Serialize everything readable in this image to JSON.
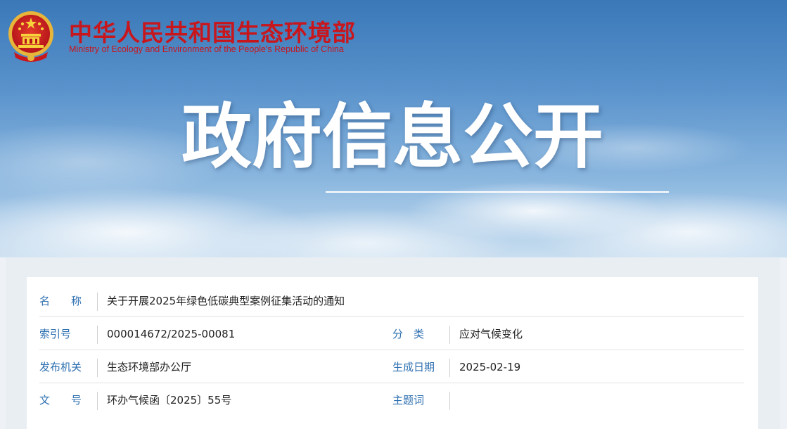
{
  "header": {
    "ministry_cn": "中华人民共和国生态环境部",
    "ministry_en": "Ministry of Ecology and Environment of the People's Republic of China",
    "emblem_icon": "national-emblem-icon"
  },
  "banner": {
    "title": "政府信息公开"
  },
  "info": {
    "name_label": "名　　称",
    "name_value": "关于开展2025年绿色低碳典型案例征集活动的通知",
    "index_label": "索引号",
    "index_value": "000014672/2025-00081",
    "category_label": "分　类",
    "category_value": "应对气候变化",
    "publisher_label": "发布机关",
    "publisher_value": "生态环境部办公厅",
    "date_label": "生成日期",
    "date_value": "2025-02-19",
    "docno_label": "文　　号",
    "docno_value": "环办气候函〔2025〕55号",
    "subject_label": "主题词",
    "subject_value": ""
  },
  "colors": {
    "brand_red": "#c8161d",
    "label_blue": "#2d6fb0"
  }
}
